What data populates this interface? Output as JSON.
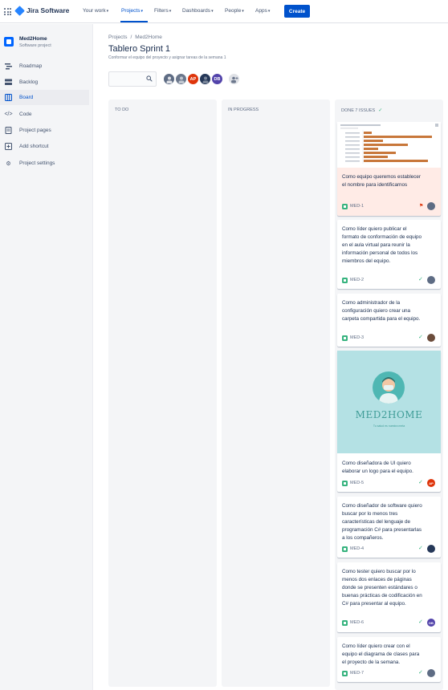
{
  "topnav": {
    "product": "Jira Software",
    "items": [
      {
        "label": "Your work"
      },
      {
        "label": "Projects"
      },
      {
        "label": "Filters"
      },
      {
        "label": "Dashboards"
      },
      {
        "label": "People"
      },
      {
        "label": "Apps"
      }
    ],
    "active_item": "Projects",
    "create_label": "Create",
    "brand_color": "#0052cc"
  },
  "sidebar": {
    "project_name": "Med2Home",
    "project_type": "Software project",
    "items": [
      {
        "label": "Roadmap",
        "icon": "roadmap-icon"
      },
      {
        "label": "Backlog",
        "icon": "backlog-icon"
      },
      {
        "label": "Board",
        "icon": "board-icon",
        "active": true
      },
      {
        "label": "Code",
        "icon": "code-icon"
      },
      {
        "label": "Project pages",
        "icon": "pages-icon"
      },
      {
        "label": "Add shortcut",
        "icon": "add-shortcut-icon"
      },
      {
        "label": "Project settings",
        "icon": "gear-icon"
      }
    ]
  },
  "header": {
    "breadcrumb": [
      "Projects",
      "Med2Home"
    ],
    "breadcrumb_sep": "/",
    "title": "Tablero Sprint 1",
    "sprint_goal": "Conformar el equipo del proyecto y asignar tareas de la semana 1"
  },
  "filters": {
    "search_placeholder": "",
    "avatars": [
      {
        "initials": "",
        "color": "#5e6c84"
      },
      {
        "initials": "",
        "color": "#6b778c"
      },
      {
        "initials": "AP",
        "color": "#de350b"
      },
      {
        "initials": "",
        "color": "#253858"
      },
      {
        "initials": "DB",
        "color": "#5243aa"
      }
    ]
  },
  "columns": [
    {
      "title": "TO DO"
    },
    {
      "title": "IN PROGRESS"
    },
    {
      "title": "DONE 7 ISSUES",
      "done": true
    }
  ],
  "cards": [
    {
      "text": "Como equipo queremos establecer el nombre para identificarnos",
      "key": "MED-1",
      "flagged": true,
      "assignee": {
        "initials": "",
        "color": "#5e6c84"
      }
    },
    {
      "text": "Como líder quiero publicar el formato de conformación de equipo en el aula virtual para reunir la información personal de todos los miembros del equipo.",
      "key": "MED-2",
      "done": true,
      "assignee": {
        "initials": "",
        "color": "#5e6c84"
      }
    },
    {
      "text": "Como administrador de la configuración quiero crear una carpeta compartida para el equipo.",
      "key": "MED-3",
      "done": true,
      "assignee": {
        "initials": "",
        "color": "#6b4c3b"
      }
    },
    {
      "text": "Como diseñadora de UI quiero elaborar un logo para el equipo.",
      "key": "MED-5",
      "done": true,
      "assignee": {
        "initials": "AP",
        "color": "#de350b"
      }
    },
    {
      "text": "Como diseñador de software quiero buscar por lo menos tres características del lenguaje de programación C# para presentarlas a los compañeros.",
      "key": "MED-4",
      "done": true,
      "assignee": {
        "initials": "",
        "color": "#253858"
      }
    },
    {
      "text": "Como tester quiero buscar por lo menos dos enlaces de páginas donde se presenten estándares o buenas prácticas de codificación en C# para presentar al equipo.",
      "key": "MED-6",
      "done": true,
      "assignee": {
        "initials": "DB",
        "color": "#5243aa"
      }
    },
    {
      "text": "Como líder quiero crear con el equipo el diagrama de clases para el proyecto de la semana.",
      "key": "MED-7",
      "done": true,
      "assignee": {
        "initials": "",
        "color": "#5e6c84"
      }
    }
  ],
  "logo_cover": {
    "title": "MED2HOME",
    "tagline": "Tu salud es nuestra meta"
  }
}
